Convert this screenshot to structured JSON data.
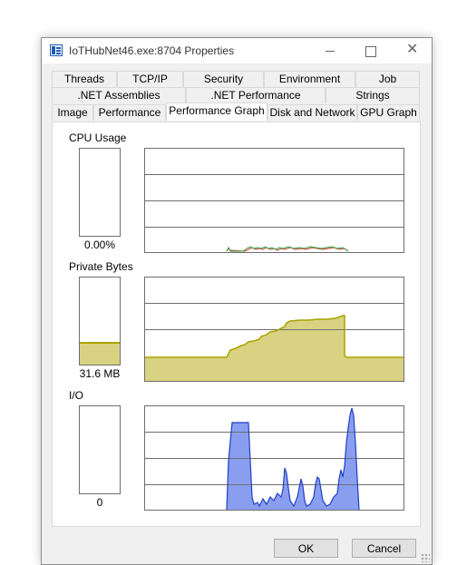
{
  "window": {
    "title": "IoTHubNet46.exe:8704 Properties",
    "close_glyph": "✕"
  },
  "tabs": {
    "row1": [
      "Threads",
      "TCP/IP",
      "Security",
      "Environment",
      "Job"
    ],
    "row2": [
      ".NET Assemblies",
      ".NET Performance",
      "Strings"
    ],
    "row3": [
      "Image",
      "Performance",
      "Performance Graph",
      "Disk and Network",
      "GPU Graph"
    ],
    "active": "Performance Graph"
  },
  "cpu": {
    "label": "CPU Usage",
    "value": "0.00%",
    "meter_fraction": 0
  },
  "private_bytes": {
    "label": "Private Bytes",
    "value": "31.6 MB",
    "meter_fraction": 0.26
  },
  "io": {
    "label": "I/O",
    "value": "0",
    "meter_fraction": 0
  },
  "colors": {
    "window_bg": "#f0f0f0",
    "graph_grid": "#6e6e6e",
    "cpu_kernel": "#d23a2c",
    "cpu_total": "#2ea043",
    "private_bytes_fill": "#d8d282",
    "private_bytes_line": "#a9a300",
    "io_fill": "#8a9ef0",
    "io_line": "#1f3fc7"
  },
  "buttons": {
    "ok": "OK",
    "cancel": "Cancel"
  }
}
